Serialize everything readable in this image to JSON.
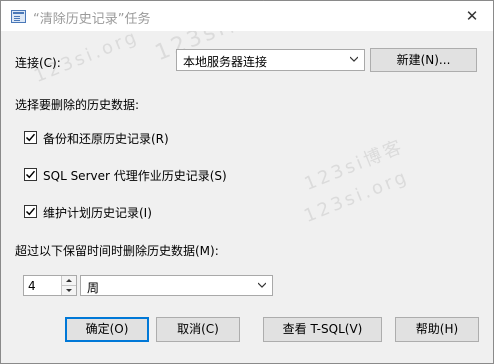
{
  "window": {
    "title": "“清除历史记录”任务",
    "close_glyph": "✕"
  },
  "connection": {
    "label": "连接(C):",
    "selected": "本地服务器连接",
    "new_button": "新建(N)..."
  },
  "history": {
    "heading": "选择要删除的历史数据:",
    "options": [
      {
        "label": "备份和还原历史记录(R)",
        "checked": true
      },
      {
        "label": "SQL Server 代理作业历史记录(S)",
        "checked": true
      },
      {
        "label": "维护计划历史记录(I)",
        "checked": true
      }
    ]
  },
  "retention": {
    "label": "超过以下保留时间时删除历史数据(M):",
    "amount": "4",
    "unit": "周"
  },
  "buttons": {
    "ok": "确定(O)",
    "cancel": "取消(C)",
    "view_tsql": "查看 T-SQL(V)",
    "help": "帮助(H)"
  },
  "watermark": {
    "line1": "123si博客",
    "line2": "123si.org"
  }
}
